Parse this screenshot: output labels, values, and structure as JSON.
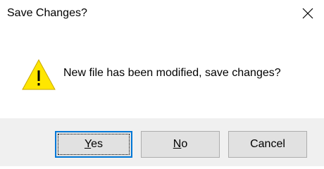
{
  "dialog": {
    "title": "Save Changes?",
    "close_icon": "close-icon",
    "message": "New file has been modified, save changes?",
    "icon": "warning-icon"
  },
  "buttons": {
    "yes": {
      "mnemonic": "Y",
      "rest": "es"
    },
    "no": {
      "mnemonic": "N",
      "rest": "o"
    },
    "cancel": {
      "label": "Cancel"
    }
  },
  "colors": {
    "warning_fill": "#ffe600",
    "focus_border": "#0078d7",
    "button_bar": "#f0f0f0",
    "button_face": "#e1e1e1"
  }
}
